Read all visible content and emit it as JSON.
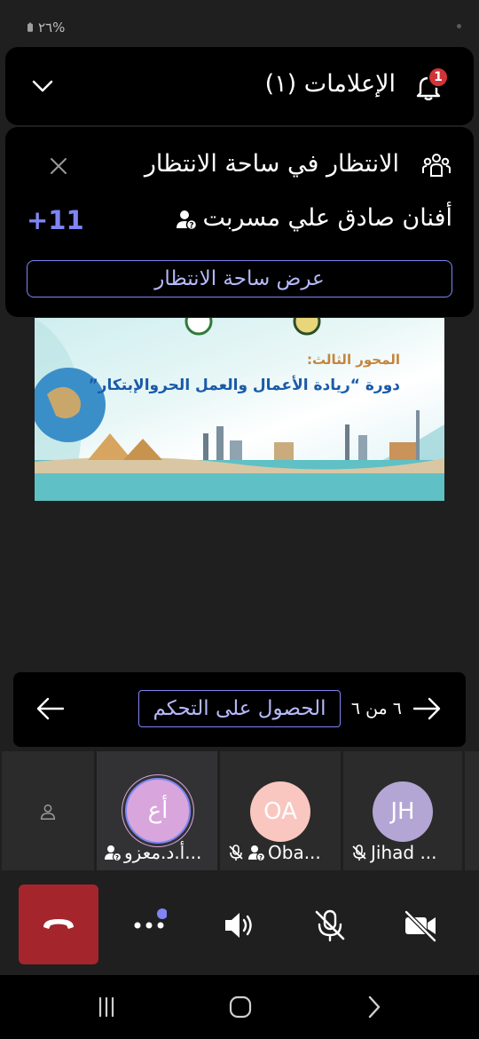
{
  "status_bar": {
    "battery": "٢٦%"
  },
  "notifications": {
    "title": "الإعلامات (١)",
    "badge_count": "1"
  },
  "lobby_notice": {
    "title": "الانتظار في ساحة الانتظار",
    "person": "أفنان صادق علي مسربت",
    "more": "+11",
    "button": "عرض ساحة الانتظار"
  },
  "shared_content": {
    "subtitle": "المحور الثالث:",
    "title": "دورة “ريادة الأعمال والعمل الحروالإبتكار”"
  },
  "control_bar": {
    "take_control": "الحصول على التحكم",
    "page": "٦ من ٦"
  },
  "participants": [
    {
      "initials": "",
      "name": ""
    },
    {
      "initials": "أع",
      "name": "أ.د.معزو...",
      "color": "#d8a6dc"
    },
    {
      "initials": "OA",
      "name": "Oba...",
      "color": "#f9c6c0"
    },
    {
      "initials": "JH",
      "name": "Jihad ...",
      "color": "#b3a6d4"
    }
  ],
  "colors": {
    "accent": "#7f85f5",
    "hangup": "#a4262c",
    "badge": "#d13438"
  }
}
